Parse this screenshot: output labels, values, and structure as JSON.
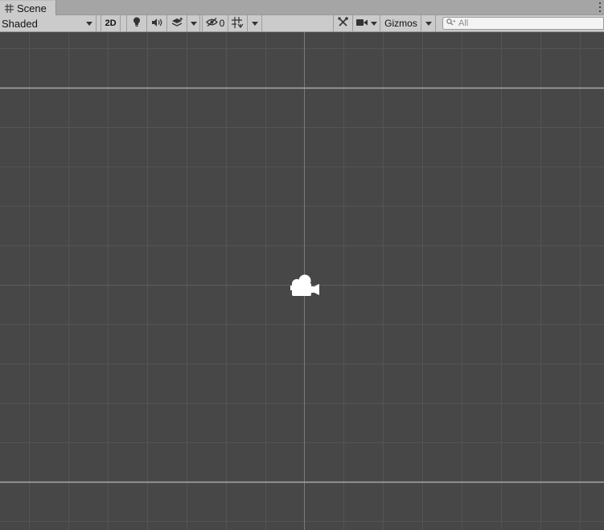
{
  "tab": {
    "title": "Scene",
    "icon": "grid-hash-icon"
  },
  "toolbar": {
    "draw_mode": "Shaded",
    "btn_2d": "2D",
    "hidden_count": "0",
    "gizmos_label": "Gizmos",
    "search_placeholder": "All"
  },
  "icons": {
    "lighting": "lightbulb-icon",
    "audio": "speaker-icon",
    "effects": "layers-effects-icon",
    "visibility": "eye-slash-icon",
    "grid": "grid-snap-icon",
    "tools": "tools-icon",
    "camera": "video-camera-icon",
    "search": "search-icon",
    "scene_camera": "scene-camera-gizmo-icon"
  },
  "colors": {
    "scene_background": "#474747",
    "toolbar_background": "#cbcbcb",
    "minor_grid": "#545454",
    "major_grid": "#a9a9a9"
  }
}
